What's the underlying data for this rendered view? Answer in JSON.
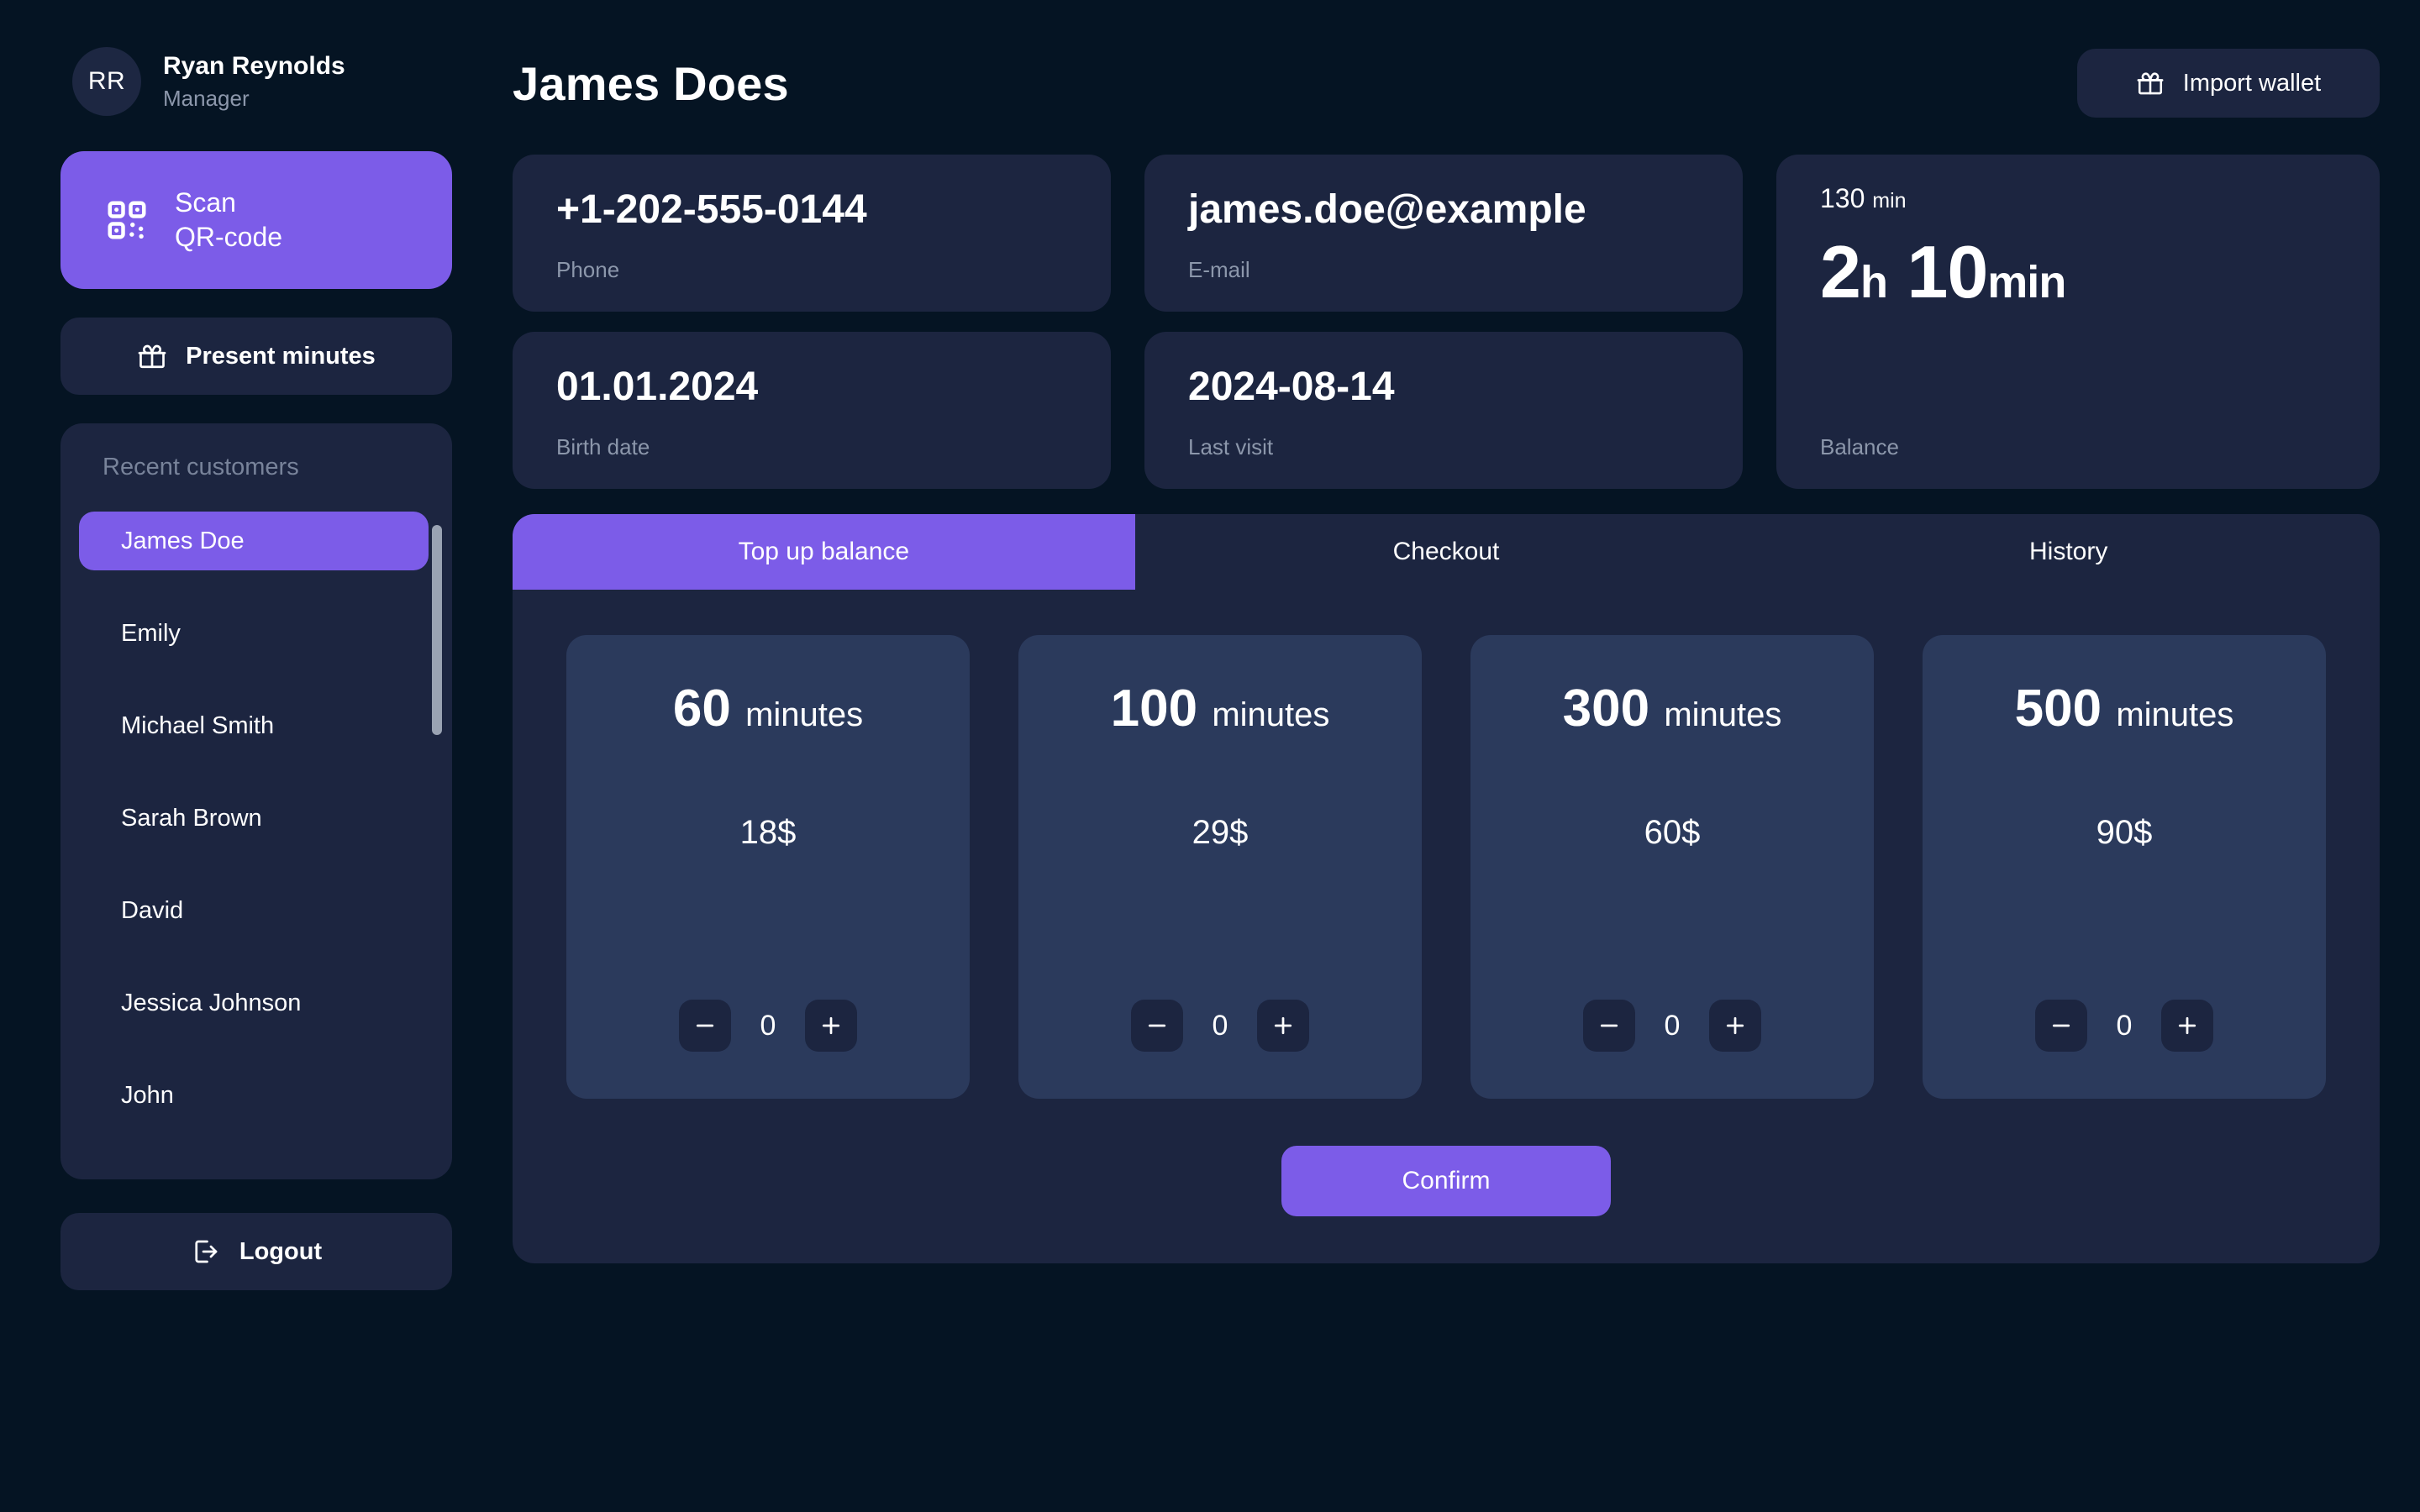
{
  "colors": {
    "background": "#051423",
    "card": "#1c2540",
    "package_card": "#2b3a5c",
    "accent_purple": "#7c5ce8",
    "muted_text": "#8c97ab",
    "text": "#ffffff"
  },
  "sidebar": {
    "profile": {
      "initials": "RR",
      "name": "Ryan Reynolds",
      "role": "Manager"
    },
    "scan_button": {
      "line1": "Scan",
      "line2": "QR-code",
      "icon": "qr-code-icon"
    },
    "present_button": {
      "label": "Present minutes",
      "icon": "gift-icon"
    },
    "customers": {
      "title": "Recent customers",
      "items": [
        {
          "name": "James Doe",
          "active": true
        },
        {
          "name": "Emily",
          "active": false
        },
        {
          "name": "Michael Smith",
          "active": false
        },
        {
          "name": "Sarah Brown",
          "active": false
        },
        {
          "name": "David",
          "active": false
        },
        {
          "name": "Jessica Johnson",
          "active": false
        },
        {
          "name": "John",
          "active": false
        }
      ]
    },
    "logout_button": {
      "label": "Logout",
      "icon": "logout-icon"
    }
  },
  "header": {
    "title": "James Does",
    "import_button": {
      "label": "Import wallet",
      "icon": "gift-icon"
    }
  },
  "info_cards": [
    {
      "value": "+1-202-555-0144",
      "label": "Phone"
    },
    {
      "value": "james.doe@example",
      "label": "E-mail"
    },
    {
      "value": "01.01.2024",
      "label": "Birth date"
    },
    {
      "value": "2024-08-14",
      "label": "Last visit"
    }
  ],
  "balance": {
    "minutes_total": "130",
    "minutes_unit": "min",
    "hours": "2",
    "hours_unit": "h",
    "minutes": "10",
    "minutes_label": "min",
    "label": "Balance"
  },
  "tabs": [
    {
      "label": "Top up balance",
      "active": true
    },
    {
      "label": "Checkout",
      "active": false
    },
    {
      "label": "History",
      "active": false
    }
  ],
  "packages": [
    {
      "amount": "60",
      "unit": "minutes",
      "price": "18$",
      "quantity": "0"
    },
    {
      "amount": "100",
      "unit": "minutes",
      "price": "29$",
      "quantity": "0"
    },
    {
      "amount": "300",
      "unit": "minutes",
      "price": "60$",
      "quantity": "0"
    },
    {
      "amount": "500",
      "unit": "minutes",
      "price": "90$",
      "quantity": "0"
    }
  ],
  "stepper": {
    "decrement_icon": "minus-icon",
    "increment_icon": "plus-icon"
  },
  "confirm_button": {
    "label": "Confirm"
  }
}
